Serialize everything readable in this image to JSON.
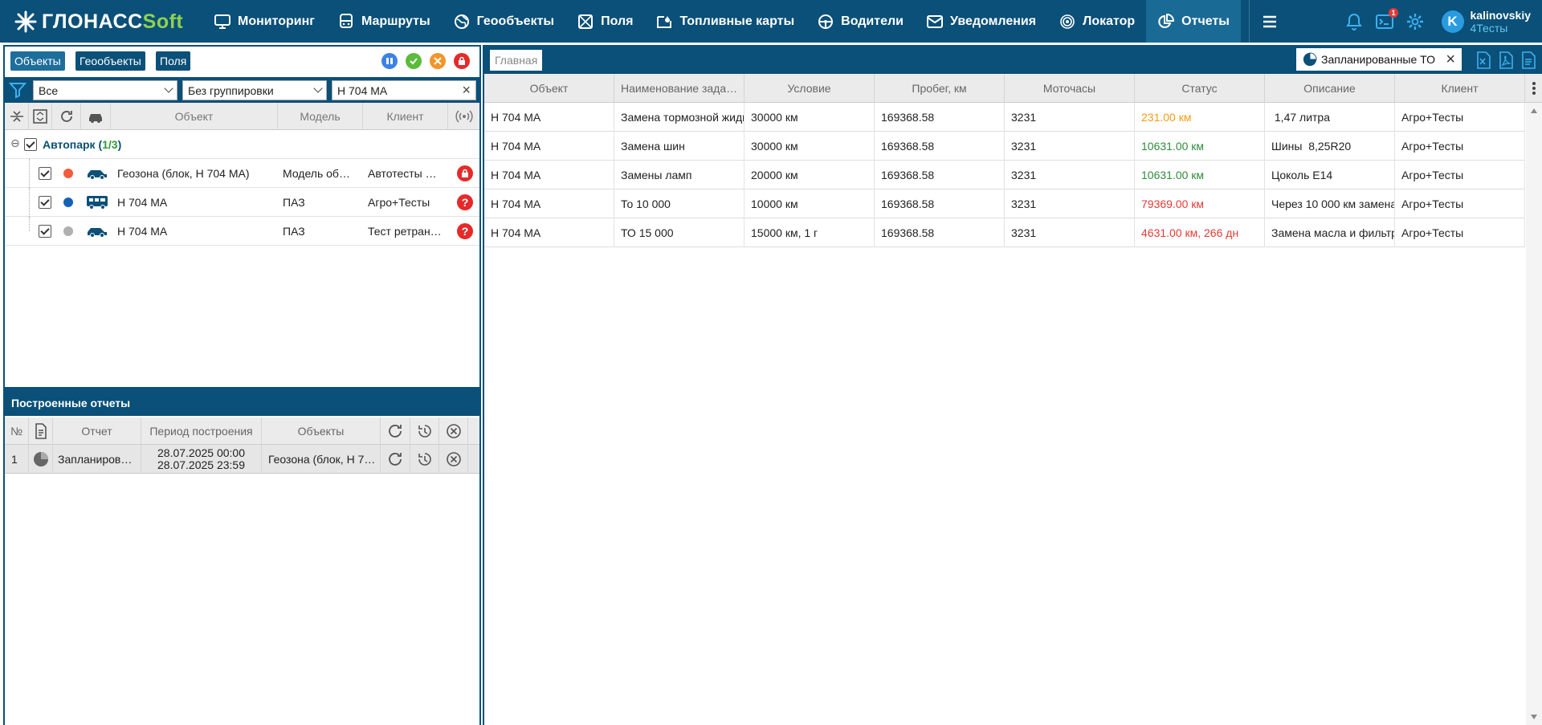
{
  "header": {
    "logo_main": "ГЛОНАСС",
    "logo_soft": "Soft",
    "nav": [
      {
        "label": "Мониторинг",
        "icon": "monitor-icon"
      },
      {
        "label": "Маршруты",
        "icon": "bus-icon"
      },
      {
        "label": "Геообъекты",
        "icon": "globe-icon"
      },
      {
        "label": "Поля",
        "icon": "field-icon"
      },
      {
        "label": "Топливные карты",
        "icon": "fuel-card-icon"
      },
      {
        "label": "Водители",
        "icon": "steering-wheel-icon"
      },
      {
        "label": "Уведомления",
        "icon": "envelope-icon"
      },
      {
        "label": "Локатор",
        "icon": "locator-icon"
      },
      {
        "label": "Отчеты",
        "icon": "reports-icon",
        "active": true
      }
    ],
    "terminal_badge": "1",
    "avatar_letter": "K",
    "user_name": "kalinovskiy",
    "user_org": "4Тесты"
  },
  "left": {
    "tabs": [
      "Объекты",
      "Геообъекты",
      "Поля"
    ],
    "filter_all": "Все",
    "grouping": "Без группировки",
    "search_value": "Н 704 МА",
    "columns": {
      "object": "Объект",
      "model": "Модель",
      "client": "Клиент"
    },
    "group": {
      "name": "Автопарк",
      "count_open": "(",
      "count_value": "1/3",
      "count_close": ")"
    },
    "objects": [
      {
        "name": "Геозона (блок, Н 704 МА)",
        "model": "Модель об…",
        "client": "Автотесты …",
        "dot": "#f25c3b",
        "status": "lock"
      },
      {
        "name": "Н 704 МА",
        "model": "ПАЗ",
        "client": "Агро+Тесты",
        "dot": "#1362b8",
        "status": "?"
      },
      {
        "name": "Н 704 МА",
        "model": "ПАЗ",
        "client": "Тест ретран…",
        "dot": "#b0b0b0",
        "status": "?"
      }
    ],
    "reports_title": "Построенные отчеты",
    "report_columns": {
      "num": "№",
      "report": "Отчет",
      "period": "Период построения",
      "objects": "Объекты"
    },
    "report_rows": [
      {
        "num": "1",
        "report": "Запланиров…",
        "period_from": "28.07.2025 00:00",
        "period_to": "28.07.2025 23:59",
        "objects": "Геозона (блок, Н 7…"
      }
    ]
  },
  "right": {
    "home_tab": "Главная",
    "report_tab": "Запланированные ТО",
    "columns": [
      "Объект",
      "Наименование зада…",
      "Условие",
      "Пробег, км",
      "Моточасы",
      "Статус",
      "Описание",
      "Клиент"
    ],
    "rows": [
      {
        "object": "Н 704 МА",
        "task": "Замена тормозной жидк",
        "condition": "30000 км",
        "mileage": "169368.58",
        "hours": "3231",
        "status": "231.00 км",
        "status_color": "#f39c12",
        "description": " 1,47 литра",
        "client": "Агро+Тесты"
      },
      {
        "object": "Н 704 МА",
        "task": "Замена шин",
        "condition": "30000 км",
        "mileage": "169368.58",
        "hours": "3231",
        "status": "10631.00 км",
        "status_color": "#2e8b3a",
        "description": "Шины  8,25R20",
        "client": "Агро+Тесты"
      },
      {
        "object": "Н 704 МА",
        "task": "Замены ламп",
        "condition": "20000 км",
        "mileage": "169368.58",
        "hours": "3231",
        "status": "10631.00 км",
        "status_color": "#2e8b3a",
        "description": "Цоколь Е14",
        "client": "Агро+Тесты"
      },
      {
        "object": "Н 704 МА",
        "task": "То 10 000",
        "condition": "10000 км",
        "mileage": "169368.58",
        "hours": "3231",
        "status": "79369.00 км",
        "status_color": "#e53935",
        "description": "Через 10 000 км замена",
        "client": "Агро+Тесты"
      },
      {
        "object": "Н 704 МА",
        "task": "ТО 15 000",
        "condition": "15000 км, 1 г",
        "mileage": "169368.58",
        "hours": "3231",
        "status": "4631.00 км, 266 дн",
        "status_color": "#e53935",
        "description": "Замена масла и фильтр",
        "client": "Агро+Тесты"
      }
    ]
  }
}
